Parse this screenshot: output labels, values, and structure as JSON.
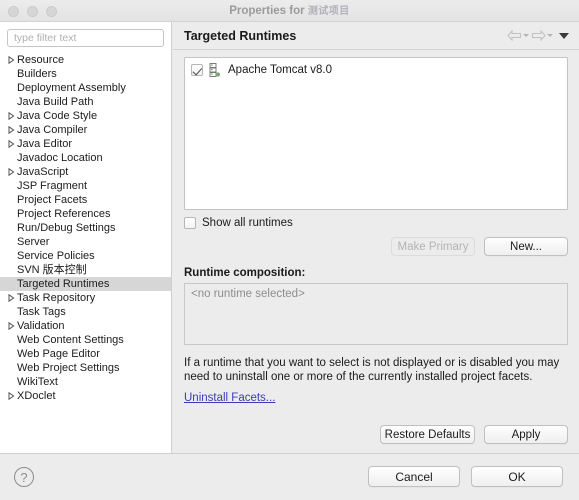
{
  "window": {
    "title_prefix": "Properties for",
    "title_project": "测试项目",
    "traffic_lights": [
      "close",
      "minimize",
      "maximize"
    ]
  },
  "sidebar": {
    "filter": {
      "placeholder": "type filter text",
      "value": ""
    },
    "items": [
      {
        "label": "Resource",
        "expandable": true,
        "selected": false
      },
      {
        "label": "Builders",
        "expandable": false,
        "selected": false
      },
      {
        "label": "Deployment Assembly",
        "expandable": false,
        "selected": false
      },
      {
        "label": "Java Build Path",
        "expandable": false,
        "selected": false
      },
      {
        "label": "Java Code Style",
        "expandable": true,
        "selected": false
      },
      {
        "label": "Java Compiler",
        "expandable": true,
        "selected": false
      },
      {
        "label": "Java Editor",
        "expandable": true,
        "selected": false
      },
      {
        "label": "Javadoc Location",
        "expandable": false,
        "selected": false
      },
      {
        "label": "JavaScript",
        "expandable": true,
        "selected": false
      },
      {
        "label": "JSP Fragment",
        "expandable": false,
        "selected": false
      },
      {
        "label": "Project Facets",
        "expandable": false,
        "selected": false
      },
      {
        "label": "Project References",
        "expandable": false,
        "selected": false
      },
      {
        "label": "Run/Debug Settings",
        "expandable": false,
        "selected": false
      },
      {
        "label": "Server",
        "expandable": false,
        "selected": false
      },
      {
        "label": "Service Policies",
        "expandable": false,
        "selected": false
      },
      {
        "label": "SVN 版本控制",
        "expandable": false,
        "selected": false
      },
      {
        "label": "Targeted Runtimes",
        "expandable": false,
        "selected": true
      },
      {
        "label": "Task Repository",
        "expandable": true,
        "selected": false
      },
      {
        "label": "Task Tags",
        "expandable": false,
        "selected": false
      },
      {
        "label": "Validation",
        "expandable": true,
        "selected": false
      },
      {
        "label": "Web Content Settings",
        "expandable": false,
        "selected": false
      },
      {
        "label": "Web Page Editor",
        "expandable": false,
        "selected": false
      },
      {
        "label": "Web Project Settings",
        "expandable": false,
        "selected": false
      },
      {
        "label": "WikiText",
        "expandable": false,
        "selected": false
      },
      {
        "label": "XDoclet",
        "expandable": true,
        "selected": false
      }
    ]
  },
  "main": {
    "page_title": "Targeted Runtimes",
    "nav": {
      "back_icon": "back-arrow-icon",
      "forward_icon": "forward-arrow-icon",
      "menu_icon": "view-menu-caret-icon"
    },
    "runtimes": [
      {
        "name": "Apache Tomcat v8.0",
        "checked": true,
        "icon": "server-runtime-icon"
      }
    ],
    "show_all_runtimes": {
      "label": "Show all runtimes",
      "checked": false
    },
    "buttons": {
      "make_primary": {
        "label": "Make Primary",
        "enabled": false
      },
      "new": {
        "label": "New...",
        "enabled": true
      },
      "restore_defaults": {
        "label": "Restore Defaults",
        "enabled": true
      },
      "apply": {
        "label": "Apply",
        "enabled": true
      }
    },
    "composition": {
      "label": "Runtime composition:",
      "empty_text": "<no runtime selected>"
    },
    "hint_text": "If a runtime that you want to select is not displayed or is disabled you may need to uninstall one or more of the currently installed project facets.",
    "uninstall_link": "Uninstall Facets..."
  },
  "footer": {
    "help_icon": "help-question-icon",
    "help_glyph": "?",
    "cancel_label": "Cancel",
    "ok_label": "OK"
  },
  "colors": {
    "window_bg": "#ececec",
    "sidebar_bg": "#ffffff",
    "selection": "#d6d6d6",
    "link": "#3b3bb5",
    "tomcat_icon": "#7aa87a"
  }
}
